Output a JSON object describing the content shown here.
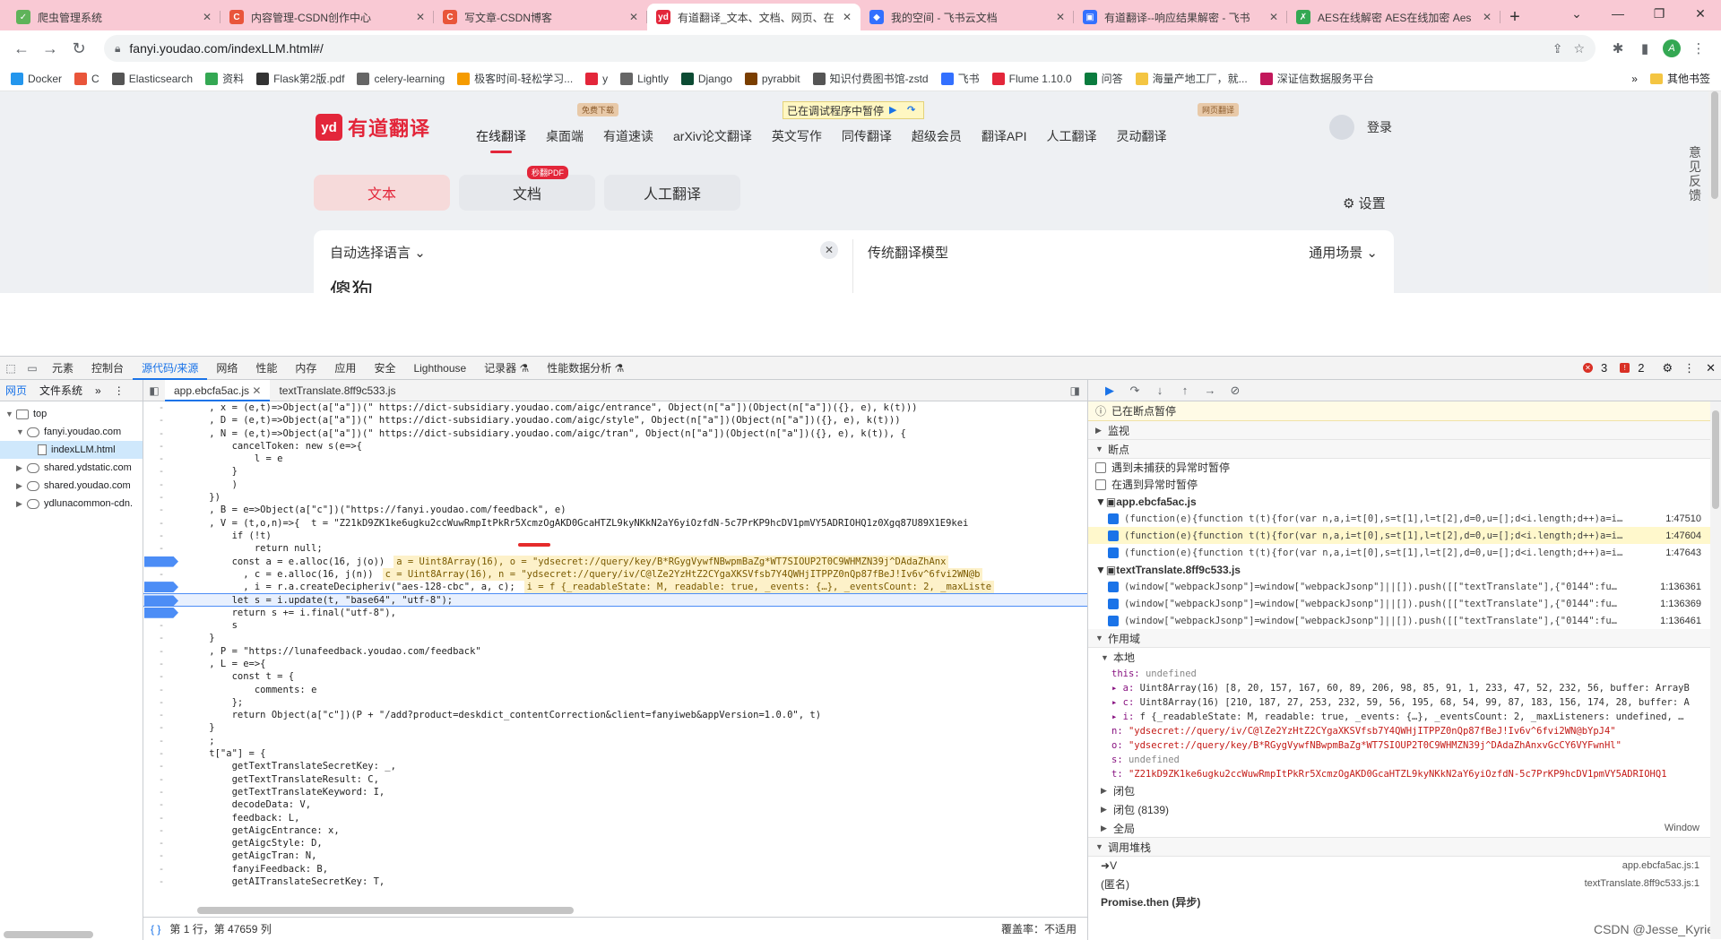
{
  "browser": {
    "tabs": [
      {
        "title": "爬虫管理系统",
        "color": "#5fb35a",
        "glyph": "✓"
      },
      {
        "title": "内容管理-CSDN创作中心",
        "color": "#e9553a",
        "glyph": "C"
      },
      {
        "title": "写文章-CSDN博客",
        "color": "#e9553a",
        "glyph": "C"
      },
      {
        "title": "有道翻译_文本、文档、网页、在",
        "color": "#e3263a",
        "glyph": "yd"
      },
      {
        "title": "我的空间 - 飞书云文档",
        "color": "#3370ff",
        "glyph": "◆"
      },
      {
        "title": "有道翻译--响应结果解密 - 飞书",
        "color": "#3370ff",
        "glyph": "▣"
      },
      {
        "title": "AES在线解密 AES在线加密 Aes",
        "color": "#34a853",
        "glyph": "✗"
      }
    ],
    "url": "fanyi.youdao.com/indexLLM.html#/",
    "avatar_letter": "A",
    "bookmarks": [
      "Docker",
      "C",
      "Elasticsearch",
      "资料",
      "Flask第2版.pdf",
      "celery-learning",
      "极客时间-轻松学习...",
      "y",
      "Lightly",
      "Django",
      "pyrabbit",
      "知识付费图书馆-zstd",
      "飞书",
      "Flume 1.10.0",
      "问答",
      "海量产地工厂，就...",
      "深证信数据服务平台"
    ],
    "bookmarks_more": "»",
    "bookmarks_other": "其他书签"
  },
  "youdao": {
    "logo_mark": "yd",
    "logo_name": "有道翻译",
    "nav": [
      "在线翻译",
      "桌面端",
      "有道速读",
      "arXiv论文翻译",
      "英文写作",
      "同传翻译",
      "超级会员",
      "翻译API",
      "人工翻译",
      "灵动翻译"
    ],
    "badge_free": "免费下载",
    "badge_web": "网页翻译",
    "debug_pill": "已在调试程序中暂停",
    "login": "登录",
    "modes": [
      "文本",
      "文档",
      "人工翻译"
    ],
    "pdf_badge": "秒翻PDF",
    "settings": "设置",
    "auto_lang": "自动选择语言",
    "source_text": "傻狗",
    "model": "传统翻译模型",
    "scene": "通用场景",
    "side_feedback": "意见反馈"
  },
  "devtools": {
    "tabs": [
      "元素",
      "控制台",
      "源代码/来源",
      "网络",
      "性能",
      "内存",
      "应用",
      "安全",
      "Lighthouse",
      "记录器 ⚗",
      "性能数据分析 ⚗"
    ],
    "errors": "3",
    "warnings": "2",
    "nav_subtabs": [
      "网页",
      "文件系统"
    ],
    "tree": [
      {
        "label": "top",
        "depth": 0,
        "icon": "frame"
      },
      {
        "label": "fanyi.youdao.com",
        "depth": 1,
        "icon": "cloud"
      },
      {
        "label": "indexLLM.html",
        "depth": 2,
        "icon": "doc"
      },
      {
        "label": "shared.ydstatic.com",
        "depth": 1,
        "icon": "cloud"
      },
      {
        "label": "shared.youdao.com",
        "depth": 1,
        "icon": "cloud"
      },
      {
        "label": "ydlunacommon-cdn.",
        "depth": 1,
        "icon": "cloud"
      }
    ],
    "file_tabs": [
      "app.ebcfa5ac.js",
      "textTranslate.8ff9c533.js"
    ],
    "status": "第 1 行，第 47659 列",
    "coverage": "覆盖率：不适用",
    "paused": "已在断点暂停",
    "sections": {
      "watch": "监视",
      "breakpoints": "断点",
      "scope": "作用域",
      "local": "本地",
      "closure": "闭包",
      "closure2": "闭包 (8139)",
      "global": "全局",
      "global_val": "Window",
      "callstack": "调用堆栈"
    },
    "pause_uncaught": "遇到未捕获的异常时暂停",
    "pause_caught": "在遇到异常时暂停",
    "bp_files": [
      {
        "name": "app.ebcfa5ac.js",
        "lines": [
          {
            "code": "(function(e){function t(t){for(var n,a,i=t[0],s=t[1],l=t[2],d=0,u=[];d<i.length;d++)a=i…",
            "loc": "1:47510"
          },
          {
            "code": "(function(e){function t(t){for(var n,a,i=t[0],s=t[1],l=t[2],d=0,u=[];d<i.length;d++)a=i…",
            "loc": "1:47604"
          },
          {
            "code": "(function(e){function t(t){for(var n,a,i=t[0],s=t[1],l=t[2],d=0,u=[];d<i.length;d++)a=i…",
            "loc": "1:47643"
          }
        ]
      },
      {
        "name": "textTranslate.8ff9c533.js",
        "lines": [
          {
            "code": "(window[\"webpackJsonp\"]=window[\"webpackJsonp\"]||[]).push([[\"textTranslate\"],{\"0144\":fu…",
            "loc": "1:136361"
          },
          {
            "code": "(window[\"webpackJsonp\"]=window[\"webpackJsonp\"]||[]).push([[\"textTranslate\"],{\"0144\":fu…",
            "loc": "1:136369"
          },
          {
            "code": "(window[\"webpackJsonp\"]=window[\"webpackJsonp\"]||[]).push([[\"textTranslate\"],{\"0144\":fu…",
            "loc": "1:136461"
          }
        ]
      }
    ],
    "scope_vars": [
      {
        "k": "this",
        "v": "undefined",
        "t": "g"
      },
      {
        "k": "▸ a",
        "v": "Uint8Array(16) [8, 20, 157, 167, 60, 89, 206, 98, 85, 91, 1, 233, 47, 52, 232, 56, buffer: ArrayB",
        "t": "n"
      },
      {
        "k": "▸ c",
        "v": "Uint8Array(16) [210, 187, 27, 253, 232, 59, 56, 195, 68, 54, 99, 87, 183, 156, 174, 28, buffer: A",
        "t": "n"
      },
      {
        "k": "▸ i",
        "v": "f {_readableState: M, readable: true, _events: {…}, _eventsCount: 2, _maxListeners: undefined, …",
        "t": "n"
      },
      {
        "k": "n",
        "v": "\"ydsecret://query/iv/C@lZe2YzHtZ2CYgaXKSVfsb7Y4QWHjITPPZ0nQp87fBeJ!Iv6v^6fvi2WN@bYpJ4\"",
        "t": "s"
      },
      {
        "k": "o",
        "v": "\"ydsecret://query/key/B*RGygVywfNBwpmBaZg*WT7SIOUP2T0C9WHMZN39j^DAdaZhAnxvGcCY6VYFwnHl\"",
        "t": "s"
      },
      {
        "k": "s",
        "v": "undefined",
        "t": "g"
      },
      {
        "k": "t",
        "v": "\"Z21kD9ZK1ke6ugku2ccWuwRmpItPkRr5XcmzOgAKD0GcaHTZL9kyNKkN2aY6yiOzfdN-5c7PrKP9hcDV1pmVY5ADRIOHQ1",
        "t": "s"
      }
    ],
    "stack": [
      {
        "fn": "V",
        "loc": "app.ebcfa5ac.js:1",
        "cur": true
      },
      {
        "fn": "(匿名)",
        "loc": "textTranslate.8ff9c533.js:1",
        "cur": false
      },
      {
        "fn": "Promise.then (异步)",
        "loc": "",
        "cur": false
      }
    ],
    "code_lines": [
      {
        "g": "-",
        "t": "    , x = (e,t)=>Object(a[\"a\"])(\" https://dict-subsidiary.youdao.com/aigc/entrance\", Object(n[\"a\"])(Object(n[\"a\"])({}, e), k(t)))"
      },
      {
        "g": "-",
        "t": "    , D = (e,t)=>Object(a[\"a\"])(\" https://dict-subsidiary.youdao.com/aigc/style\", Object(n[\"a\"])(Object(n[\"a\"])({}, e), k(t)))"
      },
      {
        "g": "-",
        "t": "    , N = (e,t)=>Object(a[\"a\"])(\" https://dict-subsidiary.youdao.com/aigc/tran\", Object(n[\"a\"])(Object(n[\"a\"])({}, e), k(t)), {"
      },
      {
        "g": "-",
        "t": "        cancelToken: new s(e=>{"
      },
      {
        "g": "-",
        "t": "            l = e"
      },
      {
        "g": "-",
        "t": "        }"
      },
      {
        "g": "-",
        "t": "        )"
      },
      {
        "g": "-",
        "t": "    })"
      },
      {
        "g": "-",
        "t": "    , B = e=>Object(a[\"c\"])(\"https://fanyi.youdao.com/feedback\", e)"
      },
      {
        "g": "-",
        "t": "    , V = (t,o,n)=>{  t = \"Z21kD9ZK1ke6ugku2ccWuwRmpItPkRr5XcmzOgAKD0GcaHTZL9kyNKkN2aY6yiOzfdN-5c7PrKP9hcDV1pmVY5ADRIOHQ1z0Xgq87U89X1E9kei"
      },
      {
        "g": "-",
        "t": "        if (!t)"
      },
      {
        "g": "-",
        "t": "            return null;"
      },
      {
        "g": "bp",
        "t": "        const a = e.alloc(16, j(o))",
        "i": "a = Uint8Array(16), o = \"ydsecret://query/key/B*RGygVywfNBwpmBaZg*WT7SIOUP2T0C9WHMZN39j^DAdaZhAnx"
      },
      {
        "g": "-",
        "t": "          , c = e.alloc(16, j(n))",
        "i": "c = Uint8Array(16), n = \"ydsecret://query/iv/C@lZe2YzHtZ2CYgaXKSVfsb7Y4QWHjITPPZ0nQp87fBeJ!Iv6v^6fvi2WN@b"
      },
      {
        "g": "bp",
        "t": "          , i = r.a.createDecipheriv(\"aes-128-cbc\", a, c);",
        "i": "i = f {_readableState: M, readable: true, _events: {…}, _eventsCount: 2, _maxListe"
      },
      {
        "g": "bp",
        "t": "        let s = i.update(t, \"base64\", \"utf-8\");",
        "cur": true
      },
      {
        "g": "bp",
        "t": "        return s += i.final(\"utf-8\"),"
      },
      {
        "g": "-",
        "t": "        s"
      },
      {
        "g": "-",
        "t": "    }"
      },
      {
        "g": "-",
        "t": "    , P = \"https://lunafeedback.youdao.com/feedback\""
      },
      {
        "g": "-",
        "t": "    , L = e=>{"
      },
      {
        "g": "-",
        "t": "        const t = {"
      },
      {
        "g": "-",
        "t": "            comments: e"
      },
      {
        "g": "-",
        "t": "        };"
      },
      {
        "g": "-",
        "t": "        return Object(a[\"c\"])(P + \"/add?product=deskdict_contentCorrection&client=fanyiweb&appVersion=1.0.0\", t)"
      },
      {
        "g": "-",
        "t": "    }"
      },
      {
        "g": "-",
        "t": "    ;"
      },
      {
        "g": "-",
        "t": "    t[\"a\"] = {"
      },
      {
        "g": "-",
        "t": "        getTextTranslateSecretKey: _,"
      },
      {
        "g": "-",
        "t": "        getTextTranslateResult: C,"
      },
      {
        "g": "-",
        "t": "        getTextTranslateKeyword: I,"
      },
      {
        "g": "-",
        "t": "        decodeData: V,"
      },
      {
        "g": "-",
        "t": "        feedback: L,"
      },
      {
        "g": "-",
        "t": "        getAigcEntrance: x,"
      },
      {
        "g": "-",
        "t": "        getAigcStyle: D,"
      },
      {
        "g": "-",
        "t": "        getAigcTran: N,"
      },
      {
        "g": "-",
        "t": "        fanyiFeedback: B,"
      },
      {
        "g": "-",
        "t": "        getAITranslateSecretKey: T,"
      }
    ]
  },
  "watermark": "CSDN @Jesse_Kyrie"
}
